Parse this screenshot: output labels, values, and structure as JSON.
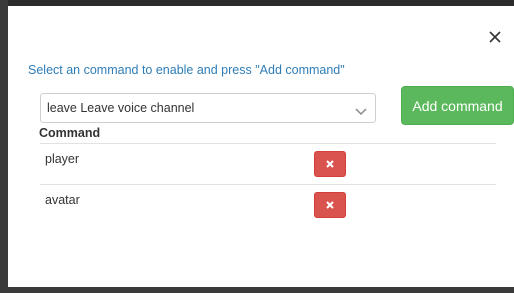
{
  "dialog": {
    "close_icon": "close-icon",
    "instruction": "Select an command to enable and press \"Add command\"",
    "select": {
      "value": "leave Leave voice channel",
      "icon": "chevron-down-icon"
    },
    "add_button_label": "Add command",
    "table": {
      "header": "Command",
      "rows": [
        {
          "label": "player",
          "delete_icon": "times-icon"
        },
        {
          "label": "avatar",
          "delete_icon": "times-icon"
        }
      ]
    }
  },
  "colors": {
    "accent_link": "#2f7db8",
    "success": "#5cb85c",
    "danger": "#d9534f"
  }
}
